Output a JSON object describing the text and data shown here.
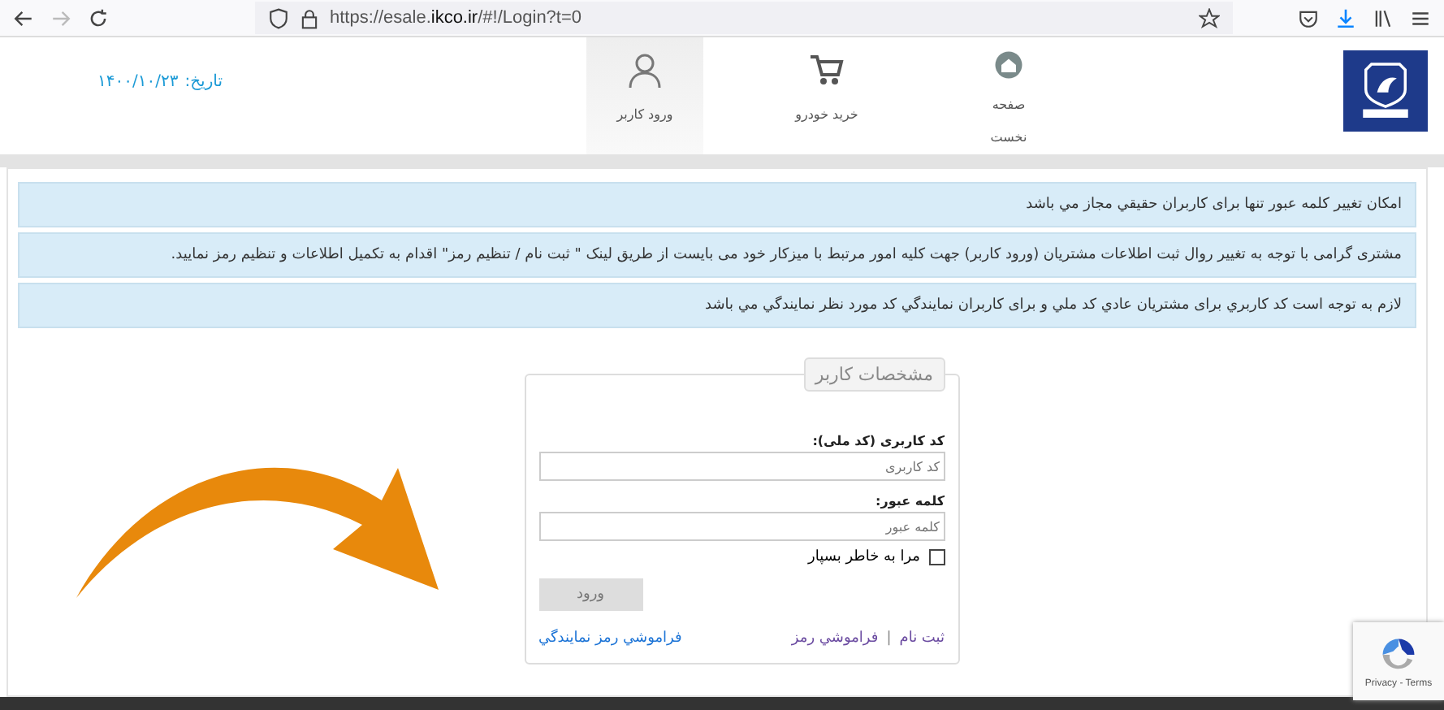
{
  "browser": {
    "url_prefix": "https://esale.",
    "url_domain": "ikco.ir",
    "url_rest": "/#!/Login?t=0"
  },
  "nav": {
    "items": [
      {
        "label": "صفحه نخست",
        "kind": "home",
        "selected": false
      },
      {
        "label": "خرید خودرو",
        "kind": "cart",
        "selected": false
      },
      {
        "label": "ورود کاربر",
        "kind": "user",
        "selected": true
      }
    ],
    "date_label": "تاریخ:",
    "date": "۱۴۰۰/۱۰/۲۳"
  },
  "notices": [
    "امکان تغییر کلمه عبور تنها برای کاربران حقیقي مجاز مي باشد",
    "مشتری گرامی با توجه به تغییر روال ثبت اطلاعات مشتریان (ورود کاربر) جهت کلیه امور مرتبط با میزکار خود می بایست از طریق لینک \" ثبت نام / تنظیم رمز\" اقدام به تکمیل اطلاعات و تنظیم رمز نمایید.",
    "لازم به توجه است کد کاربري برای مشتریان عادي کد ملي و برای کاربران نمایندگي کد مورد نظر نمایندگي مي باشد"
  ],
  "login": {
    "legend": "مشخصات کاربر",
    "fields": [
      {
        "label": "کد کاربری (کد ملی):",
        "placeholder": "کد کاربری"
      },
      {
        "label": "کلمه عبور:",
        "placeholder": "کلمه عبور"
      }
    ],
    "remember": {
      "label": "مرا به خاطر بسپار",
      "checked": false
    },
    "submit": {
      "label": "ورود",
      "disabled": true
    },
    "links": [
      "ثبت نام",
      "فراموشي رمز"
    ],
    "separator": "|",
    "agent_link": "فراموشي رمز نمایندگي"
  },
  "recaptcha": {
    "text": "Privacy - Terms"
  }
}
